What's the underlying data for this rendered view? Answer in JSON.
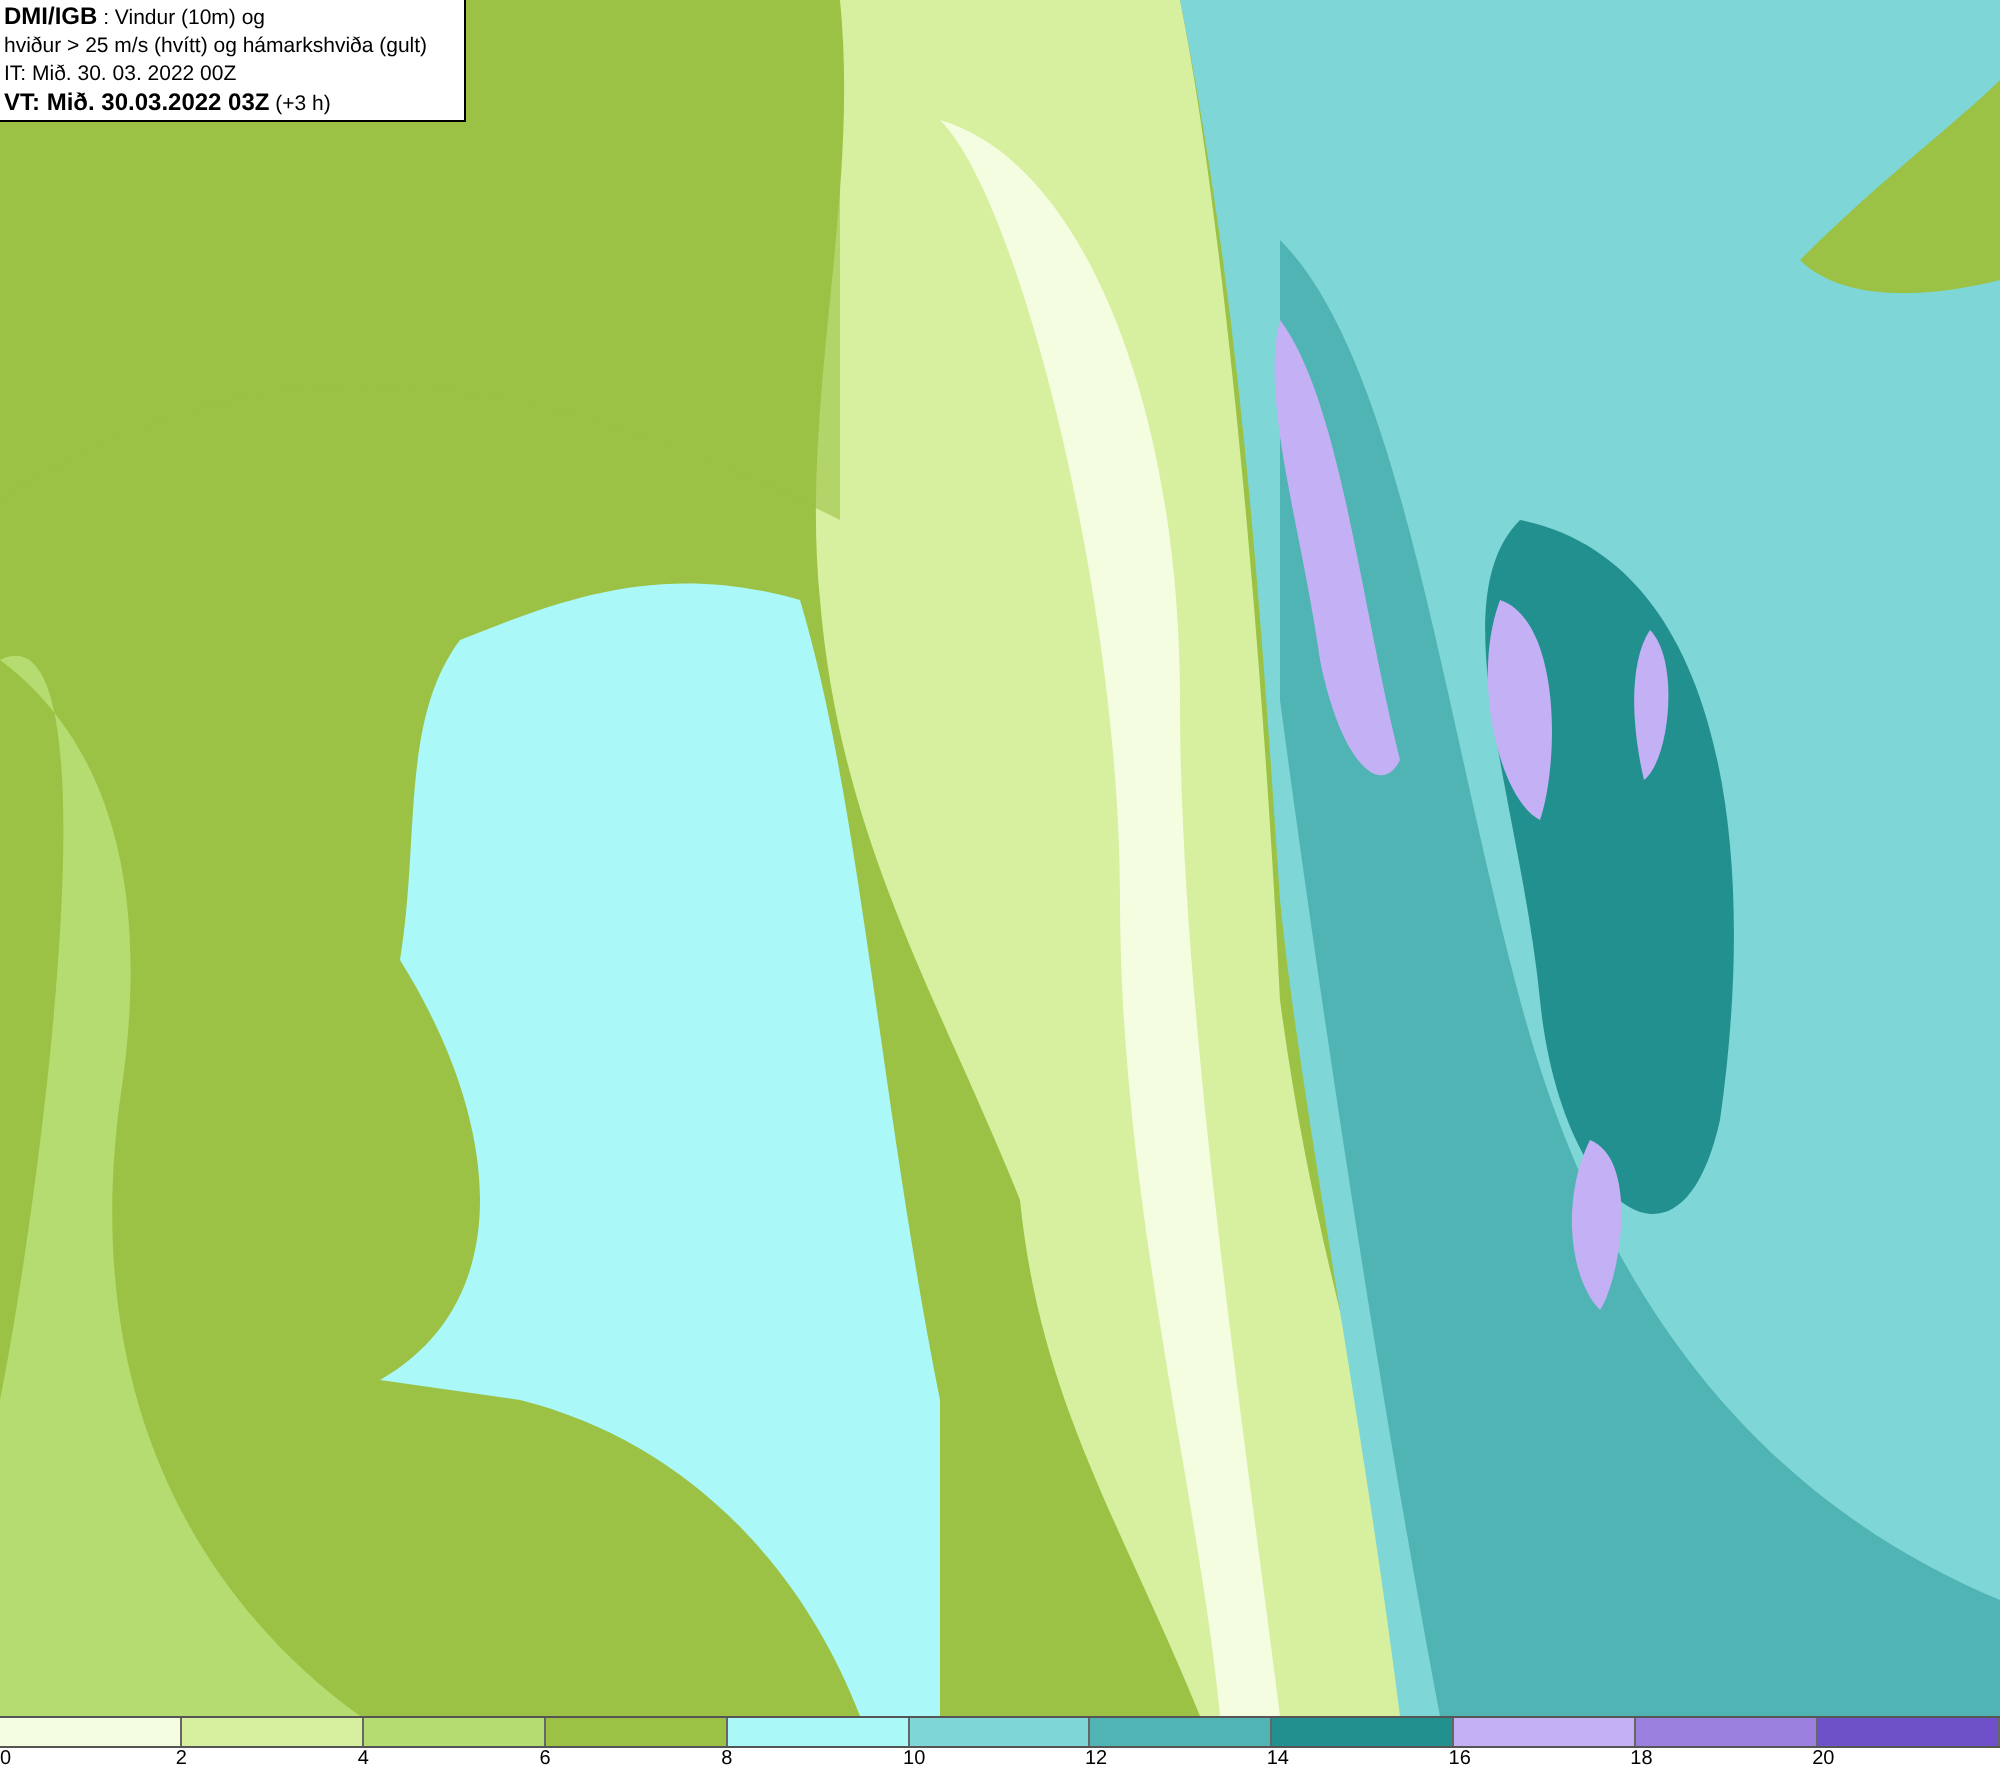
{
  "title_box": {
    "source": "DMI/IGB",
    "line_1": ": Vindur (10m) og",
    "line_2": "hviður > 25 m/s (hvítt) og hámarkshviða (gult)",
    "init_time": "IT: Mið. 30. 03. 2022 00Z",
    "valid_time": "VT: Mið. 30.03.2022 03Z",
    "lead": "(+3 h)"
  },
  "legend": {
    "bins": [
      {
        "color": "#f5fde0"
      },
      {
        "color": "#d6f0a0"
      },
      {
        "color": "#b5dc70"
      },
      {
        "color": "#9bc244"
      },
      {
        "color": "#aaf8f8"
      },
      {
        "color": "#7ed6d6"
      },
      {
        "color": "#50b4b4"
      },
      {
        "color": "#239090"
      },
      {
        "color": "#c4b0f4"
      },
      {
        "color": "#9b80e0"
      },
      {
        "color": "#6e50c8"
      }
    ],
    "ticks": [
      "0",
      "2",
      "4",
      "6",
      "8",
      "10",
      "12",
      "14",
      "16",
      "18",
      "20"
    ]
  }
}
